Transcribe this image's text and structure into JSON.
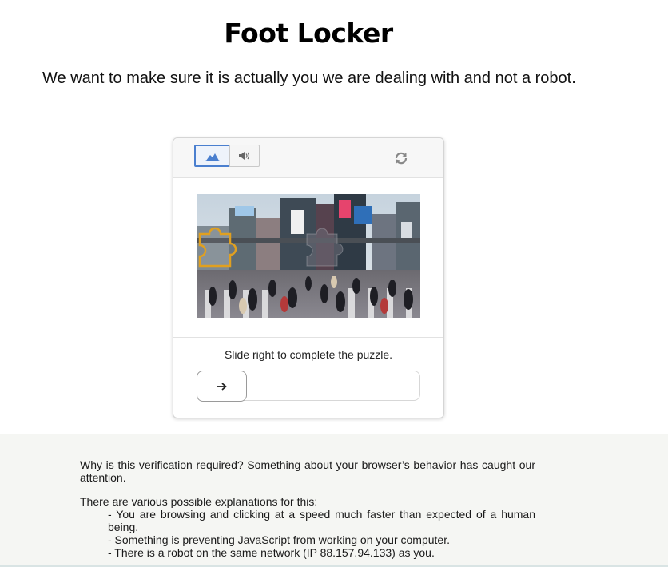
{
  "header": {
    "logo_text": "Foot Locker",
    "subtitle": "We want to make sure it is actually you we are dealing with and not a robot."
  },
  "captcha": {
    "mode_image_icon": "image-icon",
    "mode_audio_icon": "speaker-icon",
    "refresh_icon": "refresh-icon",
    "instruction": "Slide right to complete the puzzle.",
    "slider_icon": "arrow-right-icon",
    "slider_progress": 0,
    "accent_color": "#4a7fcf"
  },
  "explanation": {
    "question": "Why is this verification required? Something about your browser’s behavior has caught our attention.",
    "intro": "There are various possible explanations for this:",
    "reasons": [
      "- You are browsing and clicking at a speed much faster than expected of a human being.",
      "- Something is preventing JavaScript from working on your computer.",
      "- There is a robot on the same network (IP 88.157.94.133) as you."
    ]
  }
}
